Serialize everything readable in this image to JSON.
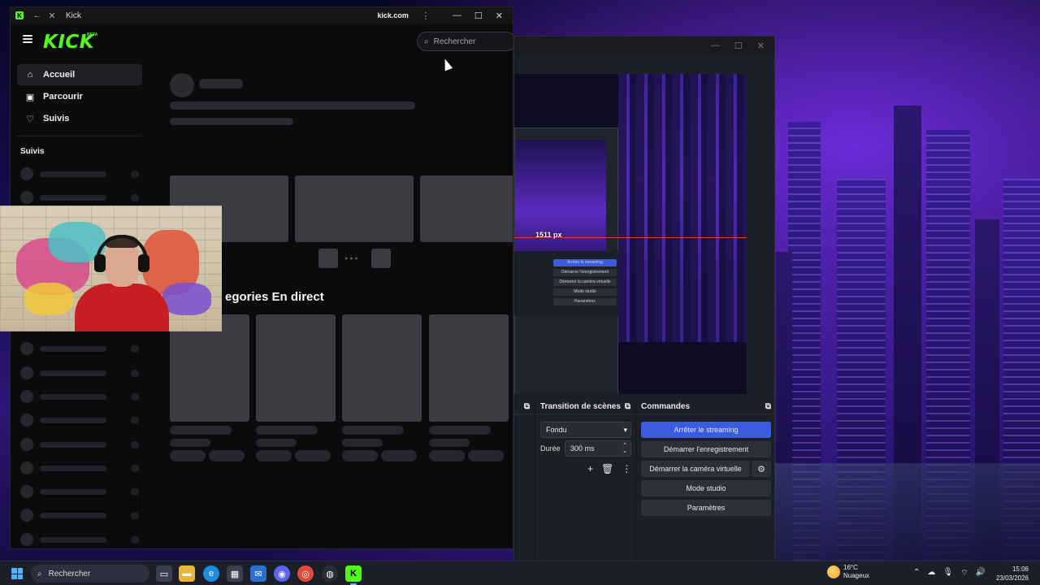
{
  "browser": {
    "tab_title": "Kick",
    "url": "kick.com",
    "logo_text": "KICK",
    "logo_badge": "BETA",
    "search_placeholder": "Rechercher"
  },
  "sidebar": {
    "nav": [
      {
        "label": "Accueil",
        "icon": "home-icon",
        "active": true
      },
      {
        "label": "Parcourir",
        "icon": "browse-icon",
        "active": false
      },
      {
        "label": "Suivis",
        "icon": "heart-icon",
        "active": false
      }
    ],
    "section_title": "Suivis"
  },
  "main": {
    "section_heading": "egories En direct"
  },
  "obs": {
    "measure_label": "1511 px",
    "nested_buttons": [
      "Arrêter le streaming",
      "Démarrer l'enregistrement",
      "Démarrer la caméra virtuelle",
      "Mode studio",
      "Paramètres"
    ],
    "transition_title": "Transition de scènes",
    "transition_value": "Fondu",
    "duration_label": "Durée",
    "duration_value": "300 ms",
    "controls_title": "Commandes",
    "buttons": {
      "stop_stream": "Arrêter le streaming",
      "start_record": "Démarrer l'enregistrement",
      "start_vcam": "Démarrer la caméra virtuelle",
      "studio_mode": "Mode studio",
      "settings": "Paramètres"
    }
  },
  "taskbar": {
    "search_label": "Rechercher",
    "weather_temp": "16°C",
    "weather_desc": "Nuageux",
    "time": "15:06",
    "date": "23/03/2026"
  },
  "colors": {
    "kick_green": "#53fc18",
    "obs_primary": "#3b5ce0"
  }
}
